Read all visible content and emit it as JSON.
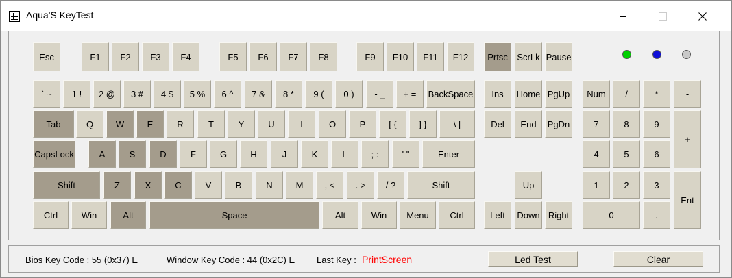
{
  "window": {
    "title": "Aqua'S KeyTest",
    "minimize_label": "Minimize",
    "maximize_label": "Maximize",
    "close_label": "Close"
  },
  "keys": [
    {
      "id": "esc",
      "label": "Esc",
      "active": false
    },
    {
      "id": "f1",
      "label": "F1",
      "active": false
    },
    {
      "id": "f2",
      "label": "F2",
      "active": false
    },
    {
      "id": "f3",
      "label": "F3",
      "active": false
    },
    {
      "id": "f4",
      "label": "F4",
      "active": false
    },
    {
      "id": "f5",
      "label": "F5",
      "active": false
    },
    {
      "id": "f6",
      "label": "F6",
      "active": false
    },
    {
      "id": "f7",
      "label": "F7",
      "active": false
    },
    {
      "id": "f8",
      "label": "F8",
      "active": false
    },
    {
      "id": "f9",
      "label": "F9",
      "active": false
    },
    {
      "id": "f10",
      "label": "F10",
      "active": false
    },
    {
      "id": "f11",
      "label": "F11",
      "active": false
    },
    {
      "id": "f12",
      "label": "F12",
      "active": false
    },
    {
      "id": "prtsc",
      "label": "Prtsc",
      "active": true
    },
    {
      "id": "scrlk",
      "label": "ScrLk",
      "active": false
    },
    {
      "id": "pause",
      "label": "Pause",
      "active": false
    },
    {
      "id": "backtick",
      "label": "` ~",
      "active": false
    },
    {
      "id": "digit1",
      "label": "1 !",
      "active": false
    },
    {
      "id": "digit2",
      "label": "2 @",
      "active": false
    },
    {
      "id": "digit3",
      "label": "3 #",
      "active": false
    },
    {
      "id": "digit4",
      "label": "4 $",
      "active": false
    },
    {
      "id": "digit5",
      "label": "5 %",
      "active": false
    },
    {
      "id": "digit6",
      "label": "6 ^",
      "active": false
    },
    {
      "id": "digit7",
      "label": "7 &",
      "active": false
    },
    {
      "id": "digit8",
      "label": "8 *",
      "active": false
    },
    {
      "id": "digit9",
      "label": "9 (",
      "active": false
    },
    {
      "id": "digit0",
      "label": "0 )",
      "active": false
    },
    {
      "id": "minus",
      "label": "- _",
      "active": false
    },
    {
      "id": "equal",
      "label": "+ =",
      "active": false
    },
    {
      "id": "backspace",
      "label": "BackSpace",
      "active": false
    },
    {
      "id": "ins",
      "label": "Ins",
      "active": false
    },
    {
      "id": "home",
      "label": "Home",
      "active": false
    },
    {
      "id": "pgup",
      "label": "PgUp",
      "active": false
    },
    {
      "id": "numlock",
      "label": "Num",
      "active": false
    },
    {
      "id": "num-divide",
      "label": "/",
      "active": false
    },
    {
      "id": "num-multiply",
      "label": "*",
      "active": false
    },
    {
      "id": "num-minus",
      "label": "-",
      "active": false
    },
    {
      "id": "tab",
      "label": "Tab",
      "active": true
    },
    {
      "id": "q",
      "label": "Q",
      "active": false
    },
    {
      "id": "w",
      "label": "W",
      "active": true
    },
    {
      "id": "e",
      "label": "E",
      "active": true
    },
    {
      "id": "r",
      "label": "R",
      "active": false
    },
    {
      "id": "t",
      "label": "T",
      "active": false
    },
    {
      "id": "y",
      "label": "Y",
      "active": false
    },
    {
      "id": "u",
      "label": "U",
      "active": false
    },
    {
      "id": "i",
      "label": "I",
      "active": false
    },
    {
      "id": "o",
      "label": "O",
      "active": false
    },
    {
      "id": "p",
      "label": "P",
      "active": false
    },
    {
      "id": "lbracket",
      "label": "[ {",
      "active": false
    },
    {
      "id": "rbracket",
      "label": "] }",
      "active": false
    },
    {
      "id": "backslash",
      "label": "\\ |",
      "active": false
    },
    {
      "id": "del",
      "label": "Del",
      "active": false
    },
    {
      "id": "end",
      "label": "End",
      "active": false
    },
    {
      "id": "pgdn",
      "label": "PgDn",
      "active": false
    },
    {
      "id": "num7",
      "label": "7",
      "active": false
    },
    {
      "id": "num8",
      "label": "8",
      "active": false
    },
    {
      "id": "num9",
      "label": "9",
      "active": false
    },
    {
      "id": "num-plus",
      "label": "+",
      "active": false
    },
    {
      "id": "capslock",
      "label": "CapsLock",
      "active": true
    },
    {
      "id": "a",
      "label": "A",
      "active": true
    },
    {
      "id": "s",
      "label": "S",
      "active": true
    },
    {
      "id": "d",
      "label": "D",
      "active": true
    },
    {
      "id": "f",
      "label": "F",
      "active": false
    },
    {
      "id": "g",
      "label": "G",
      "active": false
    },
    {
      "id": "h",
      "label": "H",
      "active": false
    },
    {
      "id": "j",
      "label": "J",
      "active": false
    },
    {
      "id": "k",
      "label": "K",
      "active": false
    },
    {
      "id": "l",
      "label": "L",
      "active": false
    },
    {
      "id": "semicolon",
      "label": "; :",
      "active": false
    },
    {
      "id": "quote",
      "label": "' \"",
      "active": false
    },
    {
      "id": "enter",
      "label": "Enter",
      "active": false
    },
    {
      "id": "num4",
      "label": "4",
      "active": false
    },
    {
      "id": "num5",
      "label": "5",
      "active": false
    },
    {
      "id": "num6",
      "label": "6",
      "active": false
    },
    {
      "id": "lshift",
      "label": "Shift",
      "active": true
    },
    {
      "id": "z",
      "label": "Z",
      "active": true
    },
    {
      "id": "x",
      "label": "X",
      "active": true
    },
    {
      "id": "c",
      "label": "C",
      "active": true
    },
    {
      "id": "v",
      "label": "V",
      "active": false
    },
    {
      "id": "b",
      "label": "B",
      "active": false
    },
    {
      "id": "n",
      "label": "N",
      "active": false
    },
    {
      "id": "m",
      "label": "M",
      "active": false
    },
    {
      "id": "comma",
      "label": ", <",
      "active": false
    },
    {
      "id": "period",
      "label": ". >",
      "active": false
    },
    {
      "id": "slash",
      "label": "/ ?",
      "active": false
    },
    {
      "id": "rshift",
      "label": "Shift",
      "active": false
    },
    {
      "id": "up",
      "label": "Up",
      "active": false
    },
    {
      "id": "num1",
      "label": "1",
      "active": false
    },
    {
      "id": "num2",
      "label": "2",
      "active": false
    },
    {
      "id": "num3",
      "label": "3",
      "active": false
    },
    {
      "id": "num-enter",
      "label": "Ent",
      "active": false
    },
    {
      "id": "lctrl",
      "label": "Ctrl",
      "active": false
    },
    {
      "id": "lwin",
      "label": "Win",
      "active": false
    },
    {
      "id": "lalt",
      "label": "Alt",
      "active": true
    },
    {
      "id": "space",
      "label": "Space",
      "active": true
    },
    {
      "id": "ralt",
      "label": "Alt",
      "active": false
    },
    {
      "id": "rwin",
      "label": "Win",
      "active": false
    },
    {
      "id": "menu",
      "label": "Menu",
      "active": false
    },
    {
      "id": "rctrl",
      "label": "Ctrl",
      "active": false
    },
    {
      "id": "left",
      "label": "Left",
      "active": false
    },
    {
      "id": "down",
      "label": "Down",
      "active": false
    },
    {
      "id": "right",
      "label": "Right",
      "active": false
    },
    {
      "id": "num0",
      "label": "0",
      "active": false
    },
    {
      "id": "num-decimal",
      "label": ".",
      "active": false
    }
  ],
  "leds": [
    {
      "id": "num-lock",
      "color": "#00d000"
    },
    {
      "id": "caps-lock",
      "color": "#1010d8"
    },
    {
      "id": "scroll-lock",
      "color": "#c8c8c8"
    }
  ],
  "status": {
    "bios_key_code": "Bios Key Code : 55 (0x37) E",
    "window_key_code": "Window Key Code : 44 (0x2C) E",
    "last_key_label": "Last Key :",
    "last_key_value": "PrintScreen",
    "last_key_color": "#ff0000",
    "led_test_button": "Led Test",
    "clear_button": "Clear"
  }
}
